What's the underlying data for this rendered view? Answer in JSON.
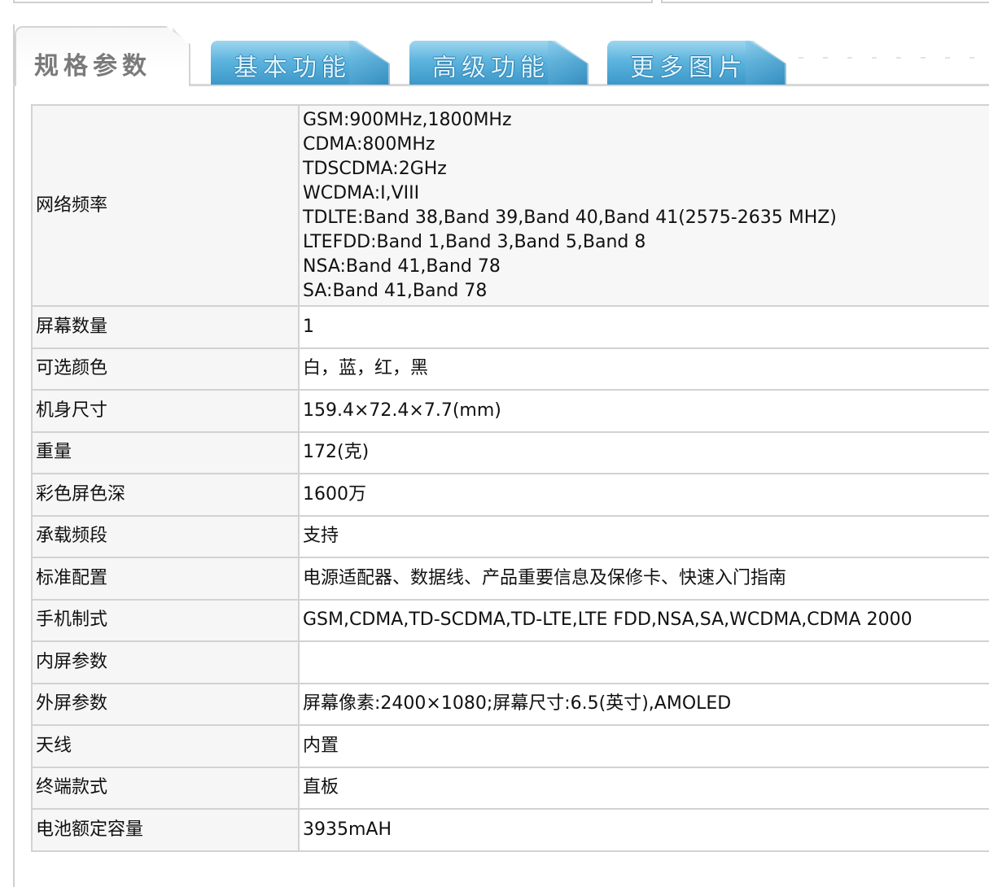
{
  "tabs": {
    "active": "规格参数",
    "items": [
      "基本功能",
      "高级功能",
      "更多图片"
    ]
  },
  "colors": {
    "tab_blue": "#4aa7d6",
    "border": "#d2d2d2",
    "key_bg": "#f6f6f6"
  },
  "specs": {
    "network": {
      "label": "网络频率",
      "lines": [
        "GSM:900MHz,1800MHz",
        "CDMA:800MHz",
        "TDSCDMA:2GHz",
        "WCDMA:I,VIII",
        "TDLTE:Band 38,Band 39,Band 40,Band 41(2575-2635 MHZ)",
        "LTEFDD:Band 1,Band 3,Band 5,Band 8",
        "NSA:Band 41,Band 78",
        "SA:Band 41,Band 78"
      ]
    },
    "rows": [
      {
        "label": "屏幕数量",
        "value": "1"
      },
      {
        "label": "可选颜色",
        "value": "白，蓝，红，黑"
      },
      {
        "label": "机身尺寸",
        "value": "159.4×72.4×7.7(mm)"
      },
      {
        "label": "重量",
        "value": "172(克)"
      },
      {
        "label": "彩色屏色深",
        "value": "1600万"
      },
      {
        "label": "承载频段",
        "value": "支持"
      },
      {
        "label": "标准配置",
        "value": "电源适配器、数据线、产品重要信息及保修卡、快速入门指南"
      },
      {
        "label": "手机制式",
        "value": "GSM,CDMA,TD-SCDMA,TD-LTE,LTE FDD,NSA,SA,WCDMA,CDMA 2000"
      },
      {
        "label": "内屏参数",
        "value": ""
      },
      {
        "label": "外屏参数",
        "value": "屏幕像素:2400×1080;屏幕尺寸:6.5(英寸),AMOLED"
      },
      {
        "label": "天线",
        "value": "内置"
      },
      {
        "label": "终端款式",
        "value": "直板"
      },
      {
        "label": "电池额定容量",
        "value": "3935mAH"
      }
    ]
  }
}
